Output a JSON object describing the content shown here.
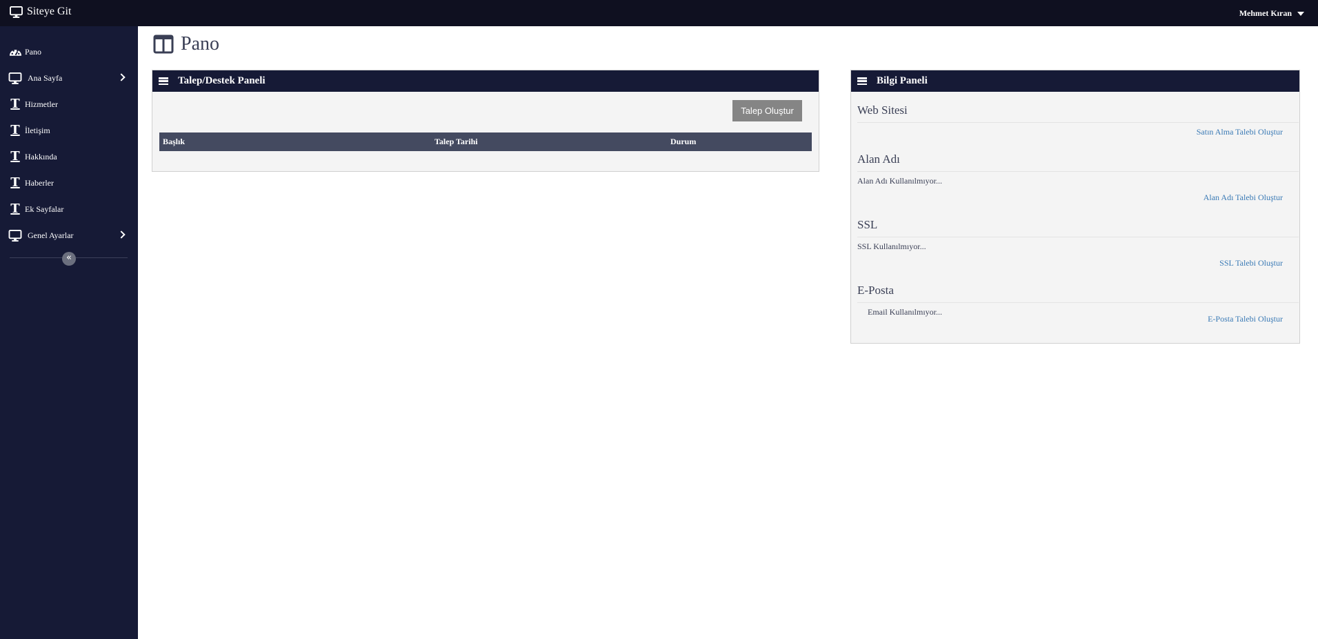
{
  "topbar": {
    "brand_label": "Siteye Git",
    "brand_icon": "monitor-icon",
    "user_name": "Mehmet Kıran"
  },
  "sidebar": {
    "items": [
      {
        "label": "Pano",
        "icon": "dashboard-icon"
      },
      {
        "label": "Ana Sayfa",
        "icon": "monitor-icon",
        "has_submenu": true
      },
      {
        "label": "Hizmetler",
        "icon": "text-icon"
      },
      {
        "label": "İletişim",
        "icon": "text-icon"
      },
      {
        "label": "Hakkında",
        "icon": "text-icon"
      },
      {
        "label": "Haberler",
        "icon": "text-icon"
      },
      {
        "label": "Ek Sayfalar",
        "icon": "text-icon"
      },
      {
        "label": "Genel Ayarlar",
        "icon": "monitor-icon",
        "has_submenu": true
      }
    ],
    "collapse_glyph": "«"
  },
  "page": {
    "title": "Pano",
    "title_icon": "columns-icon"
  },
  "ticket_panel": {
    "title": "Talep/Destek Paneli",
    "create_button": "Talep Oluştur",
    "columns": [
      "Başlık",
      "Talep Tarihi",
      "Durum"
    ],
    "rows": []
  },
  "info_panel": {
    "title": "Bilgi Paneli",
    "sections": [
      {
        "title": "Web Sitesi",
        "text": "",
        "link": "Satın Alma Talebi Oluştur"
      },
      {
        "title": "Alan Adı",
        "text": "Alan Adı Kullanılmıyor...",
        "link": "Alan Adı Talebi Oluştur"
      },
      {
        "title": "SSL",
        "text": "SSL Kullanılmıyor...",
        "link": "SSL Talebi Oluştur"
      },
      {
        "title": "E-Posta",
        "text": "Email Kullanılmıyor...",
        "link": "E-Posta Talebi Oluştur"
      }
    ]
  },
  "colors": {
    "topbar": "#0f1020",
    "sidebar": "#161a36",
    "panel_header": "#161a36",
    "table_header": "#444a60",
    "button": "#858585",
    "link": "#3a7ab5"
  }
}
